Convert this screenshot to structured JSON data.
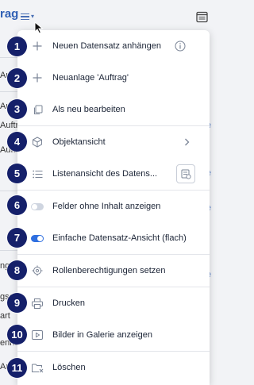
{
  "app": {
    "title_fragment": "rag",
    "row_fragments": [
      "Aufti",
      "Auftr",
      "Auftra",
      "Auftr",
      "ngsart",
      "gsart",
      "art",
      "ennan",
      "Aufti"
    ],
    "link_fragments": [
      "e",
      "e",
      "e",
      "e"
    ]
  },
  "menu": {
    "items": [
      {
        "badge": "1",
        "label": "Neuen Datensatz anhängen",
        "icon": "plus-icon",
        "trailing": "info-icon"
      },
      {
        "badge": "2",
        "label": "Neuanlage 'Auftrag'",
        "icon": "plus-icon"
      },
      {
        "badge": "3",
        "label": "Als neu bearbeiten",
        "icon": "copy-icon"
      },
      {
        "badge": "4",
        "label": "Objektansicht",
        "icon": "cube-icon",
        "trailing": "chevron-right-icon"
      },
      {
        "badge": "5",
        "label": "Listenansicht des Datens...",
        "icon": "list-icon",
        "trailing": "list-export-icon"
      },
      {
        "badge": "6",
        "label": "Felder ohne Inhalt anzeigen",
        "icon": "toggle-off-icon",
        "toggle_on": false
      },
      {
        "badge": "7",
        "label": "Einfache Datensatz-Ansicht (flach)",
        "icon": "toggle-on-icon",
        "toggle_on": true
      },
      {
        "badge": "8",
        "label": "Rollenberechtigungen setzen",
        "icon": "target-icon"
      },
      {
        "badge": "9",
        "label": "Drucken",
        "icon": "printer-icon"
      },
      {
        "badge": "10",
        "label": "Bilder in Galerie anzeigen",
        "icon": "gallery-icon"
      },
      {
        "badge": "11",
        "label": "Löschen",
        "icon": "delete-folder-icon"
      }
    ]
  },
  "colors": {
    "badge": "#15206a",
    "toggle_on": "#2f6fe0",
    "toggle_off": "#cfd5e0",
    "icon": "#7a8496"
  }
}
